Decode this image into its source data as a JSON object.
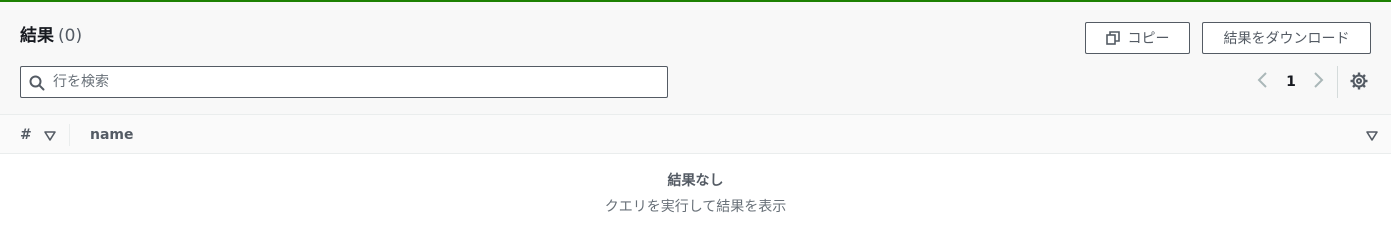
{
  "results": {
    "title": "結果",
    "count": "(0)"
  },
  "toolbar": {
    "copy_label": "コピー",
    "copy_icon": "copy-icon",
    "download_label": "結果をダウンロード"
  },
  "search": {
    "placeholder": "行を検索",
    "value": "",
    "icon": "search-icon"
  },
  "pagination": {
    "current_page": "1",
    "prev_icon": "chevron-left-icon",
    "next_icon": "chevron-right-icon",
    "settings_icon": "gear-icon"
  },
  "table": {
    "columns": [
      {
        "label": "#",
        "sort_icon": "sort-down-icon"
      },
      {
        "label": "name",
        "sort_icon": "sort-down-icon"
      }
    ],
    "rows": []
  },
  "empty_state": {
    "title": "結果なし",
    "message": "クエリを実行して結果を表示"
  },
  "colors": {
    "accent_top": "#1d8102",
    "header_bg": "#f8f8f8",
    "border": "#545b64",
    "text_primary": "#16191f",
    "text_secondary": "#545b64",
    "text_muted": "#687078"
  }
}
